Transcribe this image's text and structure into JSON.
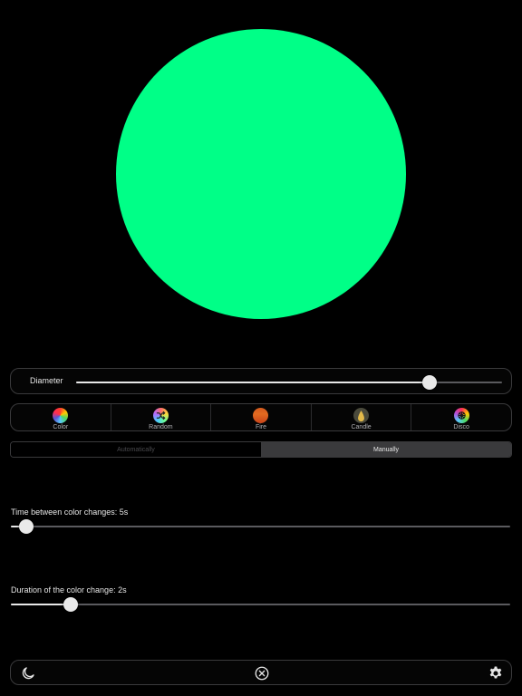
{
  "light": {
    "color": "#00ff87"
  },
  "diameter": {
    "label": "Diameter",
    "value_percent": 83
  },
  "modes": {
    "items": [
      {
        "label": "Color",
        "icon": "color-wheel-icon"
      },
      {
        "label": "Random",
        "icon": "shuffle-icon"
      },
      {
        "label": "Fire",
        "icon": "fire-icon"
      },
      {
        "label": "Candle",
        "icon": "candle-flame-icon"
      },
      {
        "label": "Disco",
        "icon": "disco-icon"
      }
    ],
    "selected": "Random"
  },
  "change_mode": {
    "options": [
      "Automatically",
      "Manually"
    ],
    "selected": "Manually"
  },
  "time_between": {
    "label": "Time between color changes: 5s",
    "value_percent": 3
  },
  "duration": {
    "label": "Duration of the color change: 2s",
    "value_percent": 12
  },
  "toolbar": {
    "left_icon": "moon-icon",
    "center_icon": "close-circle-icon",
    "right_icon": "gear-icon"
  }
}
